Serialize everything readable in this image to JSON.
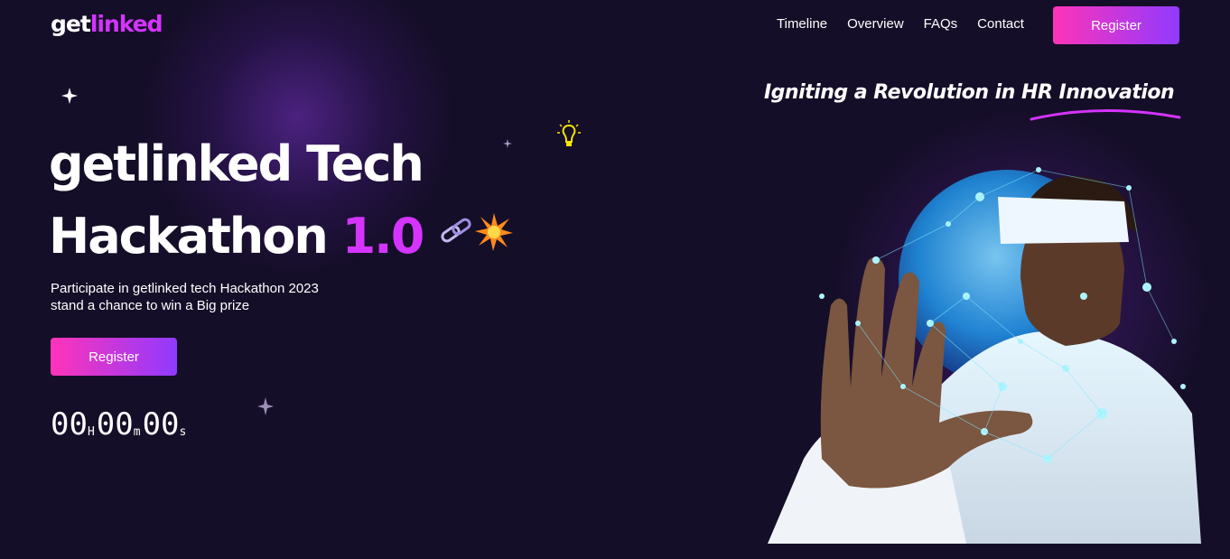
{
  "header": {
    "logo_main": "get",
    "logo_accent": "linked",
    "nav": [
      "Timeline",
      "Overview",
      "FAQs",
      "Contact"
    ],
    "register_label": "Register"
  },
  "hero": {
    "tagline": "Igniting a Revolution in HR Innovation",
    "title_line1": "getlinked Tech",
    "title_line2": "Hackathon",
    "title_version": "1.0",
    "subtitle": "Participate in getlinked tech Hackathon 2023 stand a chance to win a Big prize",
    "register_label": "Register",
    "countdown": {
      "hours": "00",
      "hours_unit": "H",
      "minutes": "00",
      "minutes_unit": "m",
      "seconds": "00",
      "seconds_unit": "s"
    }
  },
  "colors": {
    "background": "#150e28",
    "accent": "#d434fe",
    "button_start": "#fe34b9",
    "button_end": "#903aff"
  },
  "icons": [
    "sparkle-icon",
    "bulb-icon",
    "chain-icon",
    "burst-icon"
  ]
}
